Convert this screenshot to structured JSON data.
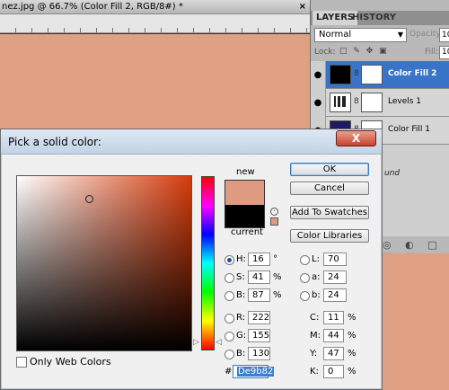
{
  "document": {
    "title": "nez.jpg @ 66.7% (Color Fill 2, RGB/8#) *",
    "close": "×"
  },
  "panels": {
    "tabs": [
      "LAYERS",
      "HISTORY"
    ],
    "blend_mode": "Normal",
    "opacity_label": "Opacity:",
    "opacity_value": "10",
    "lock_label": "Lock:",
    "lock_icons": "□ ✎ ✥ ▣",
    "fill_label": "Fill:",
    "fill_value": "10",
    "layers": [
      {
        "name": "Color Fill 2",
        "selected": true
      },
      {
        "name": "Levels 1",
        "selected": false
      },
      {
        "name": "Color Fill 1",
        "selected": false
      }
    ],
    "eye_glyph": "●",
    "link_glyph": "8",
    "background_partial": "und",
    "footer_icons": "◎ ◐ □ ▤ ▣"
  },
  "dialog": {
    "title": "Pick a solid color:",
    "close_glyph": "X",
    "new_label": "new",
    "current_label": "current",
    "new_color": "#de9b82",
    "current_color": "#000000",
    "only_web_label": "Only Web Colors",
    "buttons": {
      "ok": "OK",
      "cancel": "Cancel",
      "add_swatches": "Add To Swatches",
      "libraries": "Color Libraries"
    },
    "hsb": {
      "h_label": "H:",
      "h_value": "16",
      "h_unit": "°",
      "s_label": "S:",
      "s_value": "41",
      "s_unit": "%",
      "b_label": "B:",
      "b_value": "87",
      "b_unit": "%"
    },
    "rgb": {
      "r_label": "R:",
      "r_value": "222",
      "g_label": "G:",
      "g_value": "155",
      "b_label": "B:",
      "b_value": "130"
    },
    "lab": {
      "l_label": "L:",
      "l_value": "70",
      "a_label": "a:",
      "a_value": "24",
      "b_label": "b:",
      "b_value": "24"
    },
    "cmyk": {
      "c_label": "C:",
      "c_value": "11",
      "c_unit": "%",
      "m_label": "M:",
      "m_value": "44",
      "m_unit": "%",
      "y_label": "Y:",
      "y_value": "47",
      "y_unit": "%",
      "k_label": "K:",
      "k_value": "0",
      "k_unit": "%"
    },
    "hex_label": "#",
    "hex_value": "De9b82"
  }
}
